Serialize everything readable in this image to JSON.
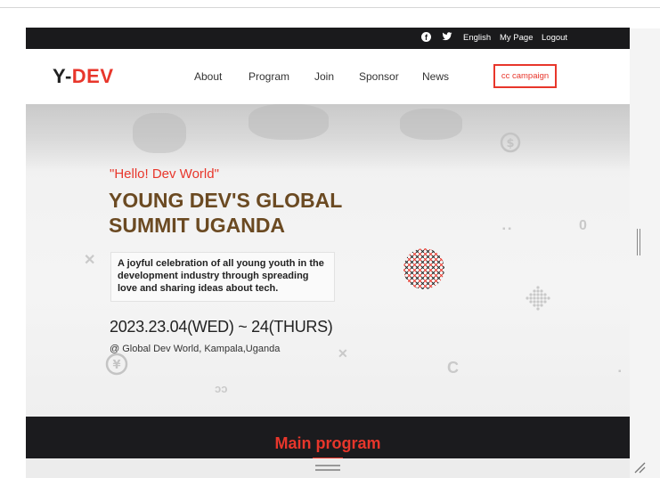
{
  "topbar": {
    "facebook_icon": "facebook-icon",
    "twitter_icon": "twitter-icon",
    "links": [
      "English",
      "My Page",
      "Logout"
    ]
  },
  "header": {
    "logo_prefix": "Y-",
    "logo_suffix": "DEV",
    "nav": [
      "About",
      "Program",
      "Join",
      "Sponsor",
      "News"
    ],
    "campaign": "cc campaign"
  },
  "hero": {
    "hello": "\"Hello! Dev World\"",
    "title_line1": "YOUNG DEV'S GLOBAL",
    "title_line2": "SUMMIT UGANDA",
    "description": "A joyful celebration of all young youth in the development industry through spreading love and sharing ideas about tech.",
    "date": "2023.23.04(WED) ~ 24(THURS)",
    "venue": "@ Global Dev World, Kampala,Uganda"
  },
  "section": {
    "title": "Main program"
  },
  "colors": {
    "accent": "#e8362b",
    "dark": "#1a1a1c",
    "title_brown": "#6b4a22"
  }
}
